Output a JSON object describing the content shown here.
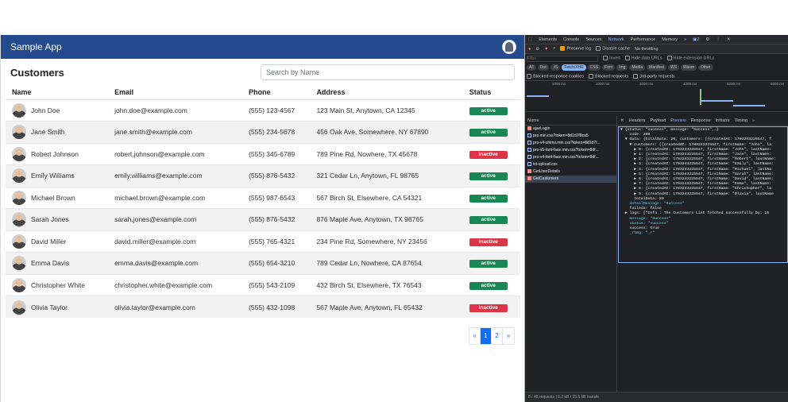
{
  "app": {
    "brand": "Sample App",
    "title": "Customers",
    "search_placeholder": "Search by Name",
    "columns": [
      "Name",
      "Email",
      "Phone",
      "Address",
      "Status"
    ],
    "rows": [
      {
        "name": "John Doe",
        "email": "john.doe@example.com",
        "phone": "(555) 123-4567",
        "address": "123 Main St, Anytown, CA 12345",
        "status": "active"
      },
      {
        "name": "Jane Smith",
        "email": "jane.smith@example.com",
        "phone": "(555) 234-5678",
        "address": "456 Oak Ave, Somewhere, NY 67890",
        "status": "active"
      },
      {
        "name": "Robert Johnson",
        "email": "robert.johnson@example.com",
        "phone": "(555) 345-6789",
        "address": "789 Pine Rd, Nowhere, TX 45678",
        "status": "inactive"
      },
      {
        "name": "Emily Williams",
        "email": "emily.williams@example.com",
        "phone": "(555) 876-5432",
        "address": "321 Cedar Ln, Anytown, FL 98765",
        "status": "active"
      },
      {
        "name": "Michael Brown",
        "email": "michael.brown@example.com",
        "phone": "(555) 987-6543",
        "address": "567 Birch St, Elsewhere, CA 54321",
        "status": "active"
      },
      {
        "name": "Sarah Jones",
        "email": "sarah.jones@example.com",
        "phone": "(555) 876-5432",
        "address": "876 Maple Ave, Anytown, TX 98765",
        "status": "active"
      },
      {
        "name": "David Miller",
        "email": "david.miller@example.com",
        "phone": "(555) 765-4321",
        "address": "234 Pine Rd, Somewhere, NY 23456",
        "status": "inactive"
      },
      {
        "name": "Emma Davis",
        "email": "emma.davis@example.com",
        "phone": "(555) 654-3210",
        "address": "789 Cedar Ln, Nowhere, CA 87654",
        "status": "active"
      },
      {
        "name": "Christopher White",
        "email": "christopher.white@example.com",
        "phone": "(555) 543-2109",
        "address": "432 Birch St, Elsewhere, TX 76543",
        "status": "active"
      },
      {
        "name": "Olivia Taylor",
        "email": "olivia.taylor@example.com",
        "phone": "(555) 432-1098",
        "address": "567 Maple Ave, Anytown, FL 65432",
        "status": "inactive"
      }
    ],
    "pagination": {
      "prev": "«",
      "pages": [
        "1",
        "2"
      ],
      "next": "»",
      "current": "1"
    },
    "colors": {
      "navbar": "#234a8c",
      "active": "#198754",
      "inactive": "#dc3545",
      "primary": "#0d6efd"
    }
  },
  "devtools": {
    "tabs": [
      "Elements",
      "Console",
      "Sources",
      "Network",
      "Performance",
      "Memory",
      "»"
    ],
    "selected_tab": "Network",
    "issues_count": "2",
    "toolbar": {
      "preserve_log": "Preserve log",
      "disable_cache": "Disable cache",
      "throttling": "No throttling"
    },
    "filter_placeholder": "Filter",
    "filter_options": [
      "Invert",
      "Hide data URLs",
      "Hide extension URLs"
    ],
    "types": [
      "All",
      "Doc",
      "JS",
      "Fetch/XHR",
      "CSS",
      "Font",
      "Img",
      "Media",
      "Manifest",
      "WS",
      "Wasm",
      "Other"
    ],
    "selected_type": "Fetch/XHR",
    "blocked_options": [
      "Blocked response cookies",
      "Blocked requests",
      "3rd-party requests"
    ],
    "timeline_ticks": [
      "1000 ms",
      "2000 ms",
      "3000 ms",
      "4000 ms",
      "5000 ms",
      "6000 ms"
    ],
    "name_header": "Name",
    "requests": [
      {
        "name": "ajaxLogin",
        "error": true
      },
      {
        "name": "pro.min.css?token=8d1d7f8ca5",
        "error": false
      },
      {
        "name": "pro-v4-shims.min.css?token=8d1d7f...",
        "error": false
      },
      {
        "name": "pro-v5-font-face.min.css?token=8df...",
        "error": false
      },
      {
        "name": "pro-v4-font-face.min.css?token=8df...",
        "error": false
      },
      {
        "name": "kit-upload.css",
        "error": false
      },
      {
        "name": "GetUserDetails",
        "error": true
      },
      {
        "name": "GetCustomers",
        "error": true
      }
    ],
    "selected_request": "GetCustomers",
    "detail_tabs": [
      "Headers",
      "Payload",
      "Preview",
      "Response",
      "Initiator",
      "Timing",
      "»"
    ],
    "selected_detail_tab": "Preview",
    "preview_lines": [
      "▼ {status: \"success\", message: \"Success\",…}",
      "    code: 200",
      "  ▼ data: {totalData: 20, customers: [{createdAt: 1703243225547, f",
      "    ▼ customers: [{createdAt: 1703243225547, firstName: \"John\", la",
      "      ▶ 0: {createdAt: 1703243225547, firstName: \"John\", lastName:",
      "      ▶ 1: {createdAt: 1703243225547, firstName: \"Jane\", lastName:",
      "      ▶ 2: {createdAt: 1703243225547, firstName: \"Robert\", lastName:",
      "      ▶ 3: {createdAt: 1703243225547, firstName: \"Emily\", lastName:",
      "      ▶ 4: {createdAt: 1703243225547, firstName: \"Michael\", lastNa",
      "      ▶ 5: {createdAt: 1703243225547, firstName: \"Sarah\", lastName:",
      "      ▶ 6: {createdAt: 1703243225547, firstName: \"David\", lastName:",
      "      ▶ 7: {createdAt: 1703243225547, firstName: \"Emma\", lastName:",
      "      ▶ 8: {createdAt: 1703243225547, firstName: \"Christopher\", la",
      "      ▶ 9: {createdAt: 1703243225547, firstName: \"Olivia\", lastName",
      "      totalData: 20",
      "    detailMessage: \"Success\"",
      "    failedx: false",
      "  ▶ logs: [\"Info : The Customers List fetched successfully by: 16",
      "    message: \"Success\"",
      "    status: \"success\"",
      "    success: true",
      "    _rtmg: \"_r\""
    ],
    "status_bar": "8 / 48 requests  |  6.2 kB / 15.5 kB transfe"
  }
}
